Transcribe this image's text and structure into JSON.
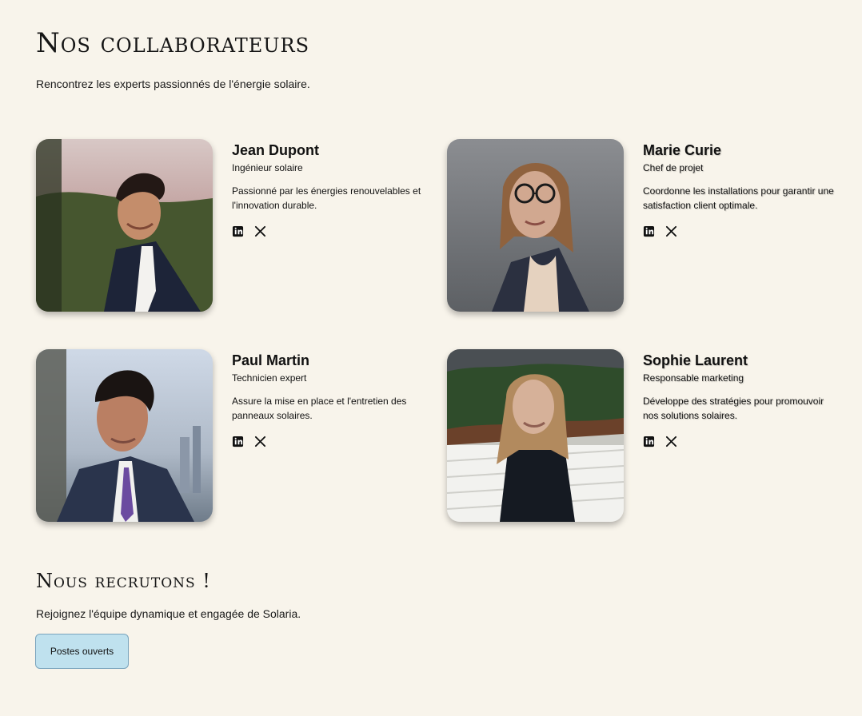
{
  "page": {
    "title": "Nos collaborateurs",
    "intro": "Rencontrez les experts passionnés de l'énergie solaire."
  },
  "team": [
    {
      "name": "Jean Dupont",
      "role": "Ingénieur solaire",
      "bio": "Passionné par les énergies renouvelables et l'innovation durable.",
      "icons": [
        "linkedin-icon",
        "x-icon"
      ]
    },
    {
      "name": "Marie Curie",
      "role": "Chef de projet",
      "bio": "Coordonne les installations pour garantir une satisfaction client optimale.",
      "icons": [
        "linkedin-icon",
        "x-icon"
      ]
    },
    {
      "name": "Paul Martin",
      "role": "Technicien expert",
      "bio": "Assure la mise en place et l'entretien des panneaux solaires.",
      "icons": [
        "linkedin-icon",
        "x-icon"
      ]
    },
    {
      "name": "Sophie Laurent",
      "role": "Responsable marketing",
      "bio": "Développe des stratégies pour promouvoir nos solutions solaires.",
      "icons": [
        "linkedin-icon",
        "x-icon"
      ]
    }
  ],
  "recruit": {
    "title": "Nous recrutons !",
    "text": "Rejoignez l'équipe dynamique et engagée de Solaria.",
    "button_label": "Postes ouverts"
  },
  "colors": {
    "background": "#f8f4eb",
    "button": "#bfe1ee",
    "button_border": "#7aa4bd",
    "text": "#111111"
  }
}
